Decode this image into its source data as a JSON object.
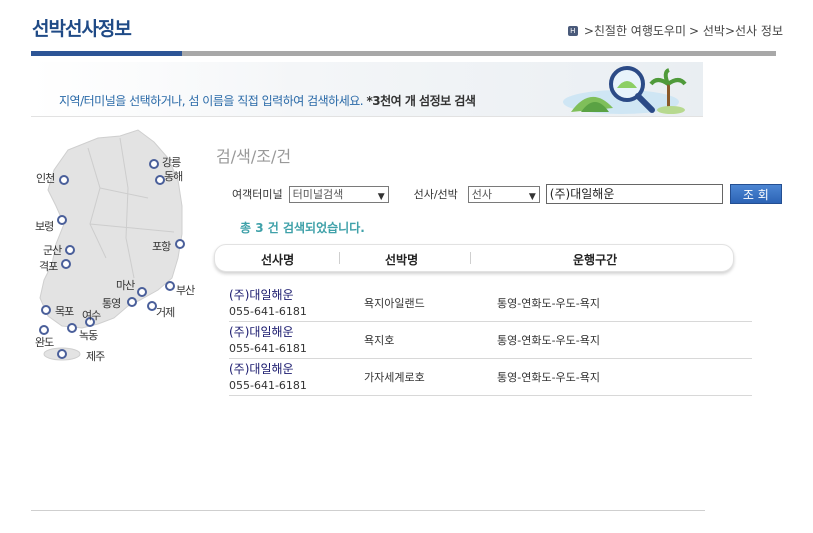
{
  "header": {
    "title": "선박선사정보",
    "breadcrumb": [
      ">친절한 여행도우미",
      "> 선박>선사 정보"
    ]
  },
  "banner": {
    "text_main": "지역/터미널을 선택하거나, 섬 이름을 직접 입력하여 검색하세요.",
    "text_bold": "*3천여 개 섬정보 검색"
  },
  "map": {
    "regions": [
      "인천",
      "강릉",
      "동해",
      "보령",
      "군산",
      "격포",
      "포항",
      "마산",
      "부산",
      "통영",
      "거제",
      "목포",
      "여수",
      "녹동",
      "완도",
      "제주"
    ]
  },
  "search": {
    "section_title": "검/색/조/건",
    "terminal_label": "여객터미널",
    "terminal_value": "터미널검색",
    "company_label": "선사/선박",
    "company_value": "선사",
    "query_value": "(주)대일해운",
    "submit_label": "조 회"
  },
  "results": {
    "count_text": "총  3 건 검색되었습니다.",
    "columns": [
      "선사명",
      "선박명",
      "운행구간"
    ],
    "rows": [
      {
        "company": "(주)대일해운",
        "phone": "055-641-6181",
        "ship": "욕지아일랜드",
        "route": "통영-연화도-우도-욕지"
      },
      {
        "company": "(주)대일해운",
        "phone": "055-641-6181",
        "ship": "욕지호",
        "route": "통영-연화도-우도-욕지"
      },
      {
        "company": "(주)대일해운",
        "phone": "055-641-6181",
        "ship": "가자세계로호",
        "route": "통영-연화도-우도-욕지"
      }
    ]
  },
  "colors": {
    "title_blue": "#1f4a86",
    "accent_blue": "#2d5596",
    "count_teal": "#3fa1a9",
    "button_blue": "#2c63b5"
  }
}
